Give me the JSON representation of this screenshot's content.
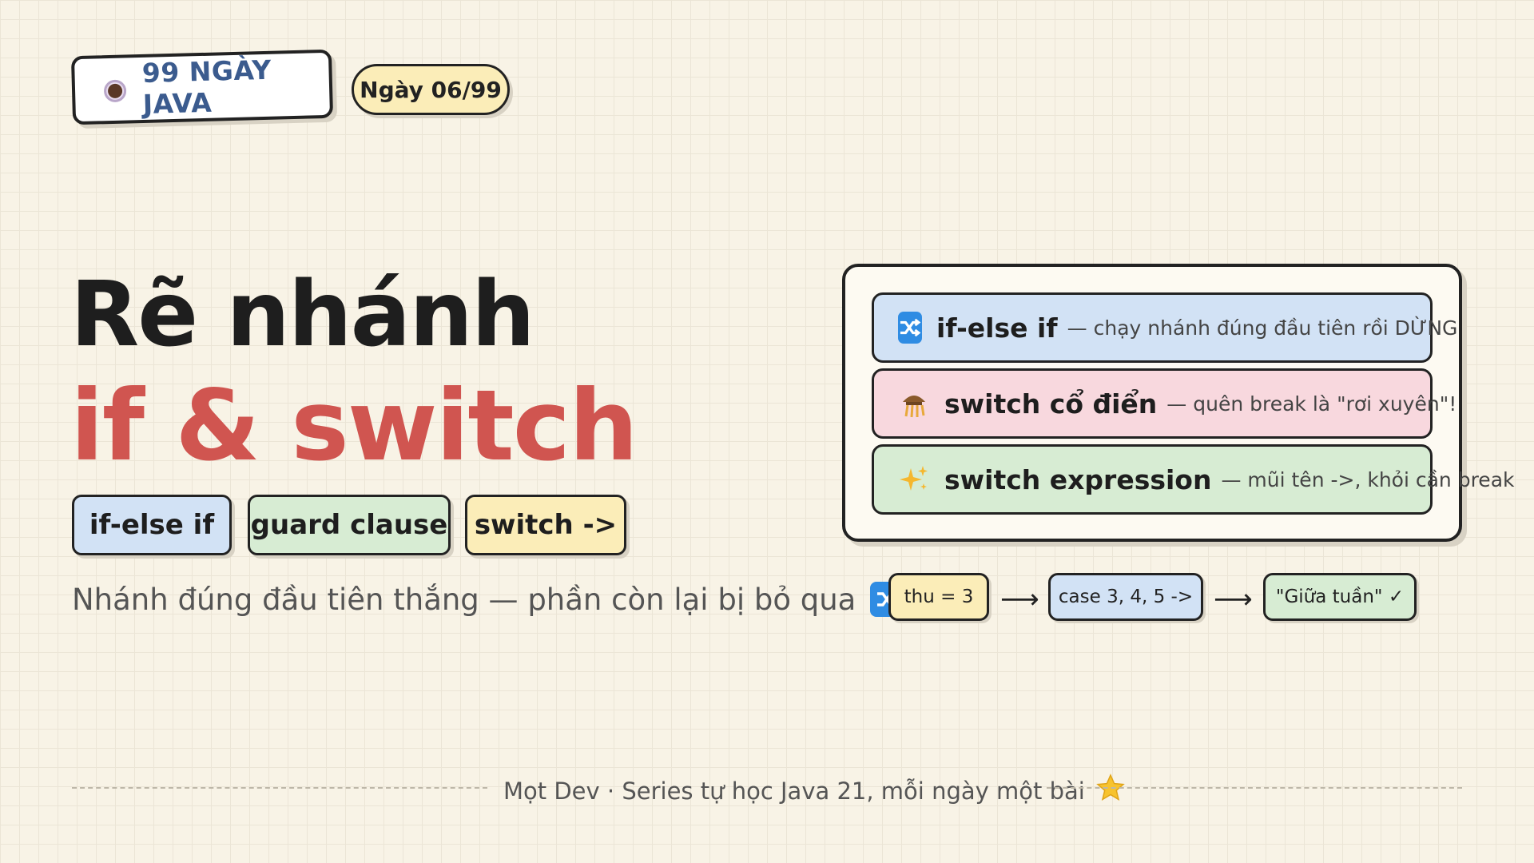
{
  "brand": {
    "label": "99 NGÀY JAVA",
    "icon": "coffee-cup-icon"
  },
  "day_badge": "Ngày 06/99",
  "title": {
    "line1": "Rẽ nhánh",
    "line2": "if & switch",
    "line2_color": "#d05550"
  },
  "tags": [
    {
      "label": "if-else if",
      "color": "#d2e2f5"
    },
    {
      "label": "guard clause",
      "color": "#d7ecd3"
    },
    {
      "label": "switch ->",
      "color": "#fbedb8"
    }
  ],
  "subtitle": "Nhánh đúng đầu tiên thắng — phần còn lại bị bỏ qua",
  "card": {
    "rows": [
      {
        "icon": "shuffle-icon",
        "title": "if-else if",
        "desc": "— chạy nhánh đúng đầu tiên rồi DỪNG",
        "color": "#d2e2f5"
      },
      {
        "icon": "waterfall-icon",
        "title": "switch cổ điển",
        "desc": "— quên break là \"rơi xuyên\"!",
        "color": "#f8d8de"
      },
      {
        "icon": "sparkles-icon",
        "title": "switch expression",
        "desc": "— mũi tên ->, khỏi cần break",
        "color": "#d7ecd3"
      }
    ]
  },
  "flow": {
    "steps": [
      "thu = 3",
      "case 3, 4, 5 ->",
      "\"Giữa tuần\" ✓"
    ],
    "arrow": "⟶"
  },
  "footer": {
    "text": "Mọt Dev · Series tự học Java 21, mỗi ngày một bài",
    "icon": "star-icon"
  }
}
